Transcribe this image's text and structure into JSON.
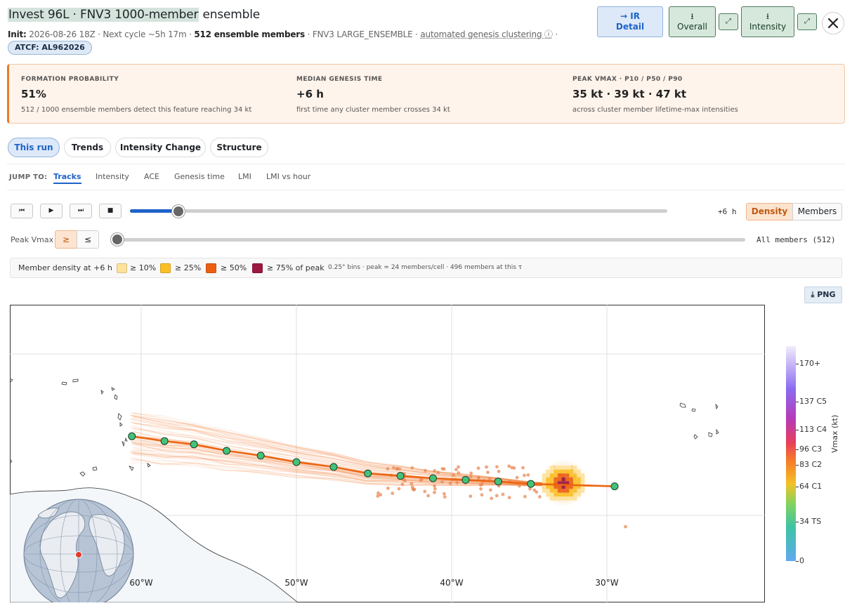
{
  "header": {
    "title_highlight": "Invest 96L · FNV3 1000-member",
    "title_rest": " ensemble",
    "init_label": "Init:",
    "init_value": "2026-08-26 18Z",
    "sep": " · ",
    "next_cycle": "Next cycle ~5h 17m",
    "members_strong": "512 ensemble members",
    "product": "FNV3 LARGE_ENSEMBLE",
    "clustering": "automated genesis clustering ⓘ",
    "tail": " ·",
    "atcf_badge": "ATCF: AL962026",
    "ir_button": "→ IR Detail",
    "overall_button": "⭳ Overall",
    "intensity_button": "⭳ Intensity",
    "expand_glyph": "⤢",
    "close_glyph": "✕"
  },
  "summary": {
    "formation": {
      "label": "FORMATION PROBABILITY",
      "value": "51%",
      "sub": "512 / 1000 ensemble members detect this feature reaching 34 kt"
    },
    "genesis": {
      "label": "MEDIAN GENESIS TIME",
      "value": "+6 h",
      "sub": "first time any cluster member crosses 34 kt"
    },
    "vmax": {
      "label": "PEAK VMAX · P10 / P50 / P90",
      "value": "35 kt · 39 kt · 47 kt",
      "sub": "across cluster member lifetime-max intensities"
    }
  },
  "tabs": [
    "This run",
    "Trends",
    "Intensity Change",
    "Structure"
  ],
  "jump": {
    "label": "JUMP TO:",
    "links": [
      "Tracks",
      "Intensity",
      "ACE",
      "Genesis time",
      "LMI",
      "LMI vs hour"
    ]
  },
  "player": {
    "controls": [
      "⏮",
      "▶",
      "⏭",
      "■"
    ],
    "time_fraction": 0.09,
    "time_label": "+6 h",
    "mode_density": "Density",
    "mode_members": "Members"
  },
  "filter": {
    "label": "Peak Vmax",
    "ge": "≥",
    "le": "≤",
    "value_fraction": 0.0,
    "readout": "All members (512)"
  },
  "legend": {
    "title": "Member density at +6 h",
    "items": [
      {
        "label": "≥ 10%",
        "color": "#fde29a"
      },
      {
        "label": "≥ 25%",
        "color": "#fbbf26"
      },
      {
        "label": "≥ 50%",
        "color": "#ec5f13"
      },
      {
        "label": "≥ 75% of peak",
        "color": "#9b1740"
      }
    ],
    "note": "0.25° bins · peak ≈ 24 members/cell · 496 members at this τ"
  },
  "png_button": "⤓ PNG",
  "map": {
    "lon_labels": [
      "60°W",
      "50°W",
      "40°W",
      "30°W"
    ],
    "track_color": "#ec6512",
    "track_points": [
      [
        -60.6,
        14.9
      ],
      [
        -58.5,
        14.6
      ],
      [
        -56.6,
        14.4
      ],
      [
        -54.5,
        14.0
      ],
      [
        -52.3,
        13.7
      ],
      [
        -50.0,
        13.3
      ],
      [
        -47.6,
        13.0
      ],
      [
        -45.4,
        12.6
      ],
      [
        -43.3,
        12.45
      ],
      [
        -41.2,
        12.3
      ],
      [
        -39.1,
        12.2
      ],
      [
        -37.0,
        12.1
      ],
      [
        -34.9,
        11.95
      ],
      [
        -29.5,
        11.8
      ]
    ],
    "density_center": [
      -32.8,
      12.0
    ],
    "point_color": "#43c27a"
  },
  "colorbar": {
    "title": "Vmax (kt)",
    "ticks": [
      {
        "label": "170+",
        "value": 170
      },
      {
        "label": "137 C5",
        "value": 137
      },
      {
        "label": "113 C4",
        "value": 113
      },
      {
        "label": "96 C3",
        "value": 96
      },
      {
        "label": "83 C2",
        "value": 83
      },
      {
        "label": "64 C1",
        "value": 64
      },
      {
        "label": "34 TS",
        "value": 34
      },
      {
        "label": "0",
        "value": 0
      }
    ]
  }
}
